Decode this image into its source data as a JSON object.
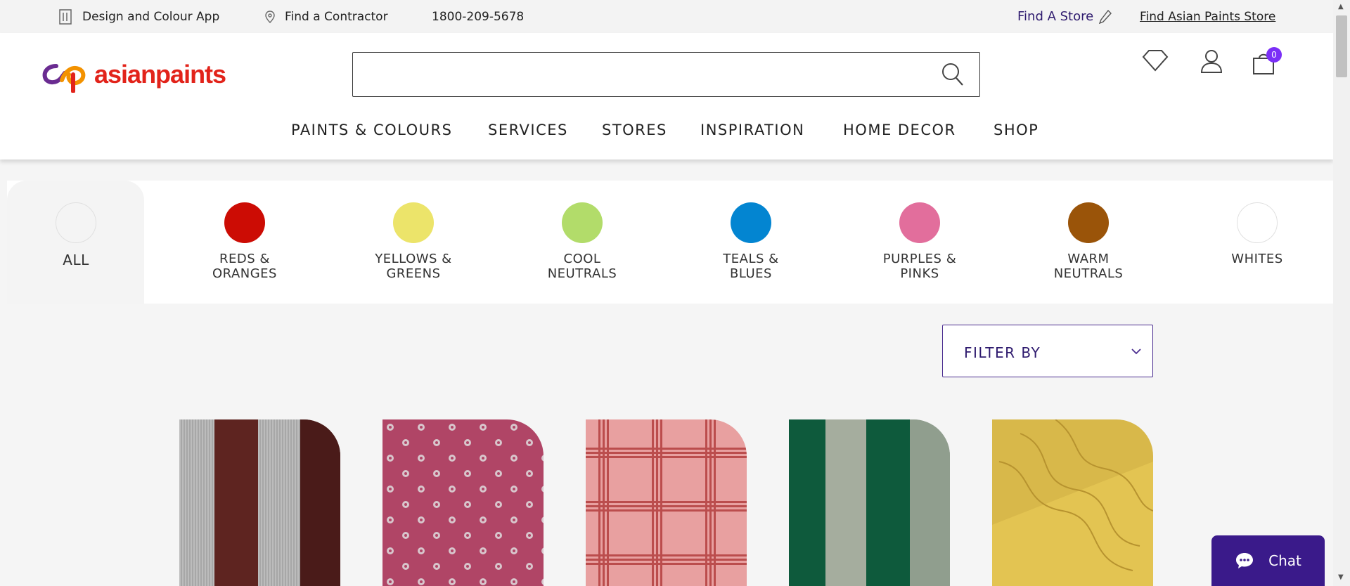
{
  "topbar": {
    "design_app": "Design and Colour App",
    "find_contractor": "Find a Contractor",
    "phone": "1800-209-5678",
    "find_store": "Find A Store",
    "find_asian_store": "Find Asian Paints Store"
  },
  "header": {
    "logo_text": "asianpaints",
    "search": {
      "value": "",
      "placeholder": ""
    },
    "cart_count": "0",
    "nav": [
      "PAINTS & COLOURS",
      "SERVICES",
      "STORES",
      "INSPIRATION",
      "HOME DECOR",
      "SHOP"
    ]
  },
  "categories": [
    {
      "label": "ALL",
      "color": "#ffffff"
    },
    {
      "label": "REDS & ORANGES",
      "color": "#cc0c04"
    },
    {
      "label": "YELLOWS & GREENS",
      "color": "#ece46a"
    },
    {
      "label": "COOL NEUTRALS",
      "color": "#b2dc6a"
    },
    {
      "label": "TEALS & BLUES",
      "color": "#0385d1"
    },
    {
      "label": "PURPLES & PINKS",
      "color": "#e26e9c"
    },
    {
      "label": "WARM NEUTRALS",
      "color": "#9a5409"
    },
    {
      "label": "WHITES",
      "color": "#ffffff"
    }
  ],
  "filter": {
    "label": "FILTER BY"
  },
  "products": [
    {
      "name": "grey-maroon-stripes"
    },
    {
      "name": "pink-polka-dots"
    },
    {
      "name": "pink-red-plaid"
    },
    {
      "name": "green-grey-stripes"
    },
    {
      "name": "gold-swirl"
    }
  ],
  "chat": {
    "label": "Chat"
  }
}
